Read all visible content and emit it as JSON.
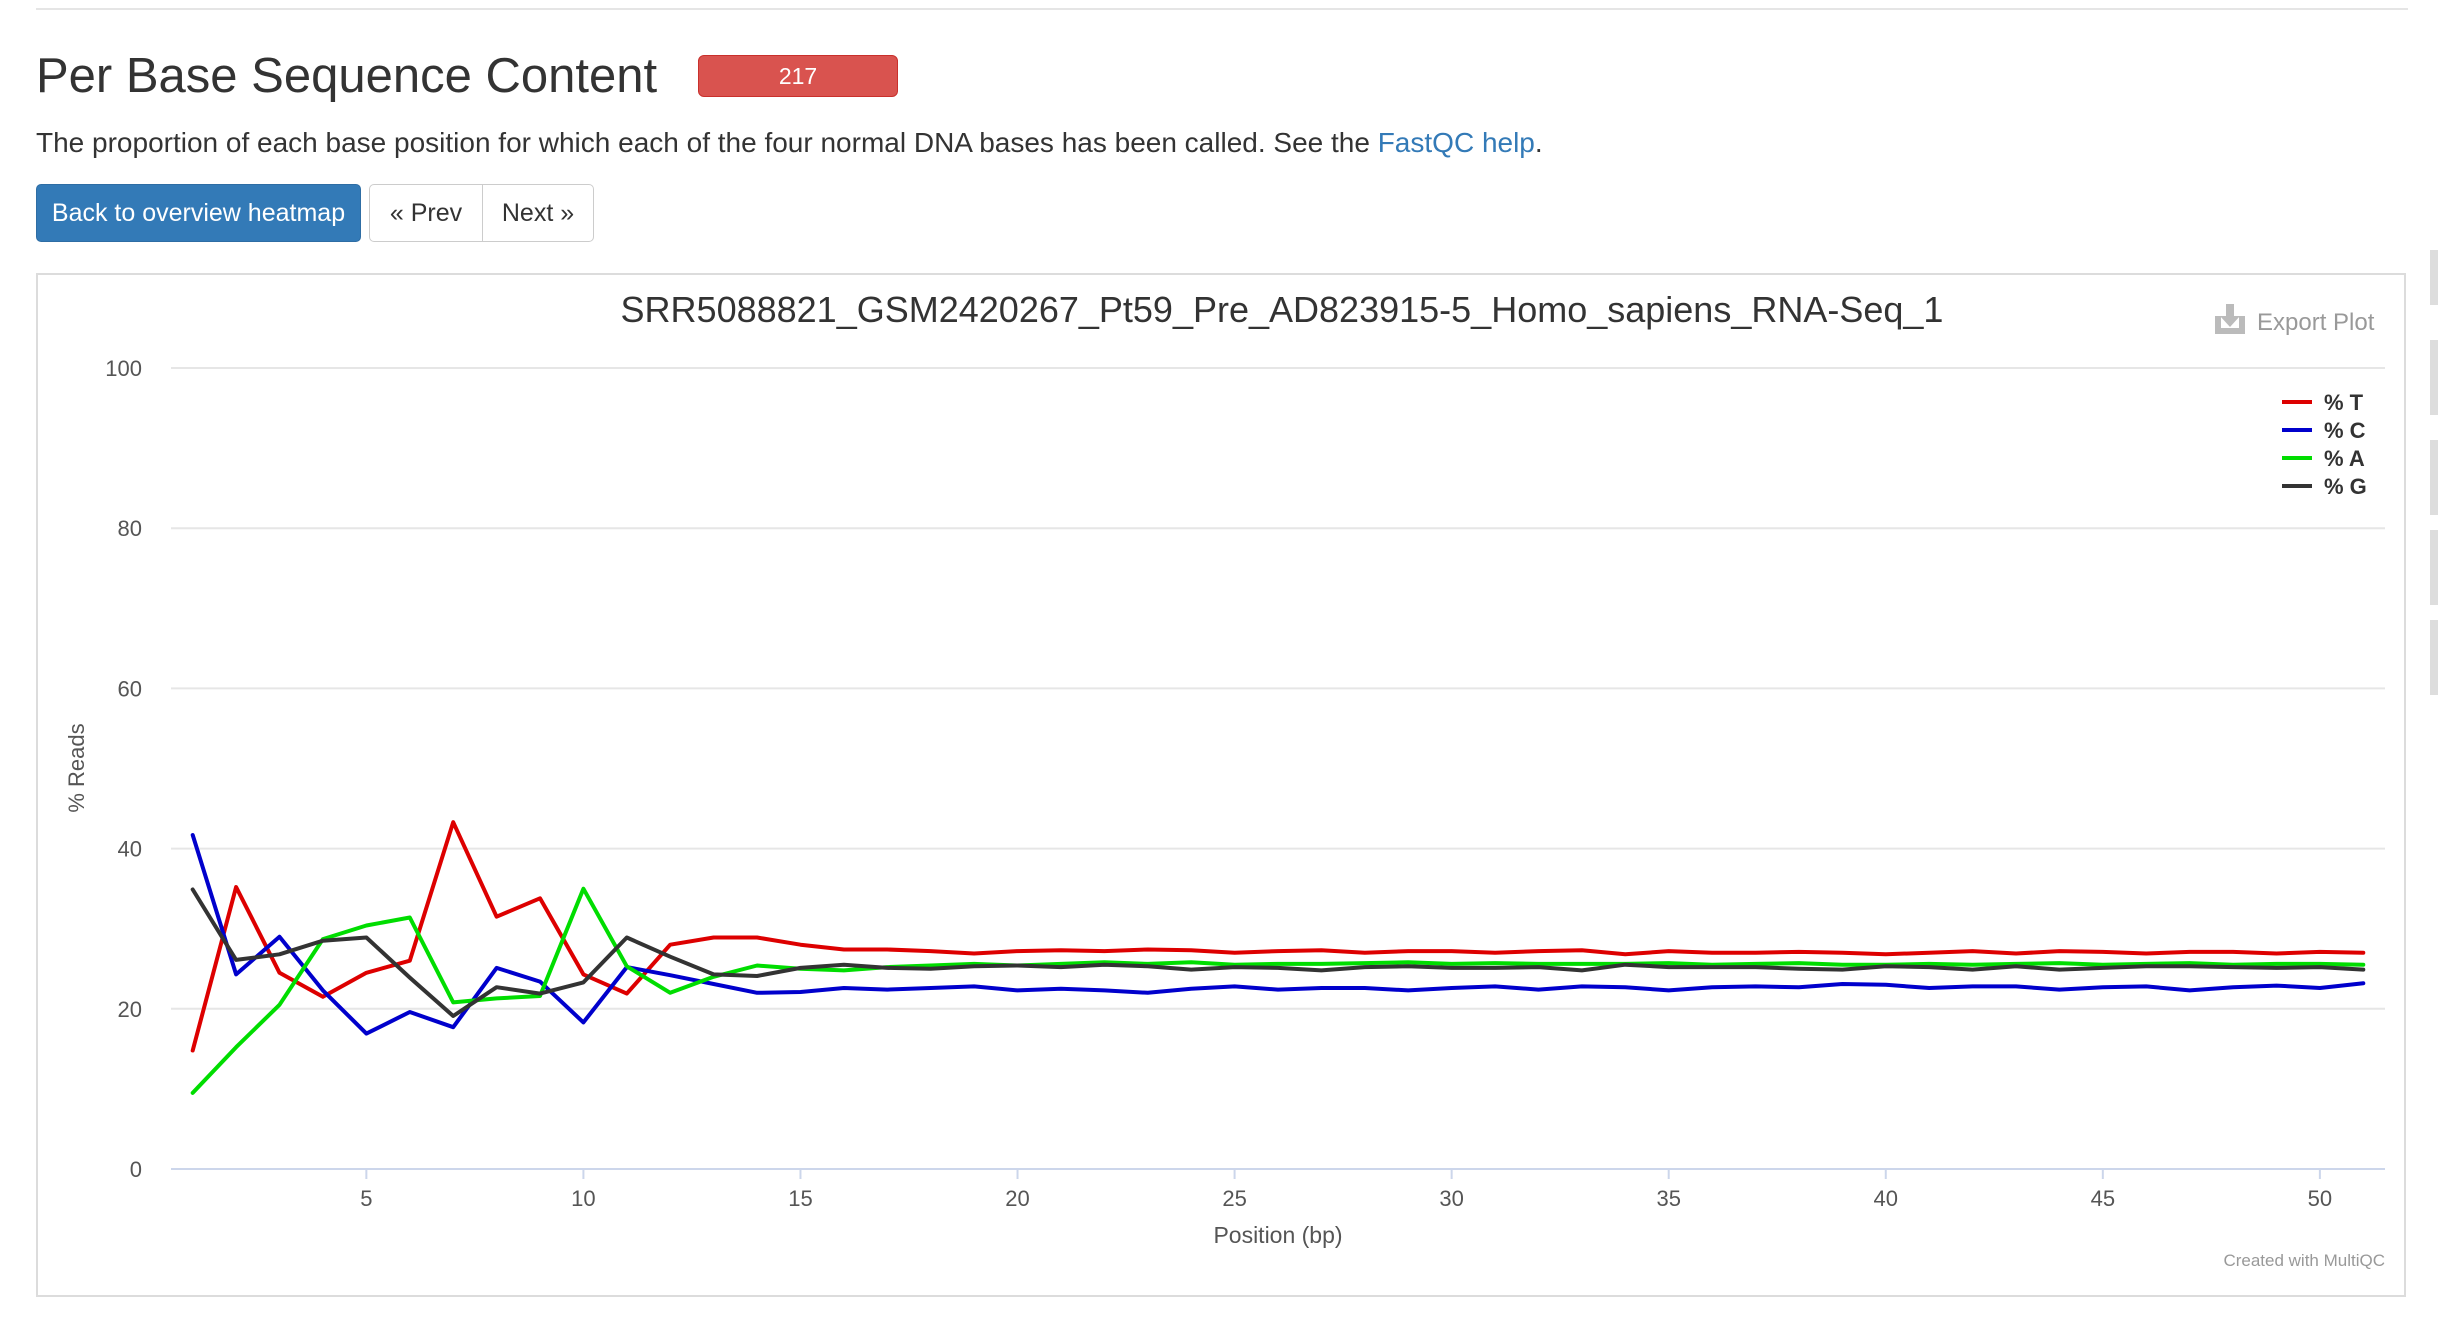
{
  "section": {
    "title": "Per Base Sequence Content",
    "badge": "217",
    "description_before": "The proportion of each base position for which each of the four normal DNA bases has been called. See the ",
    "help_link": "FastQC help",
    "description_after": "."
  },
  "nav": {
    "back_label": "Back to overview heatmap",
    "prev_label": "« Prev",
    "next_label": "Next »"
  },
  "plot": {
    "export_label": "Export Plot",
    "credit": "Created with MultiQC"
  },
  "chart_data": {
    "type": "line",
    "title": "SRR5088821_GSM2420267_Pt59_Pre_AD823915-5_Homo_sapiens_RNA-Seq_1",
    "xlabel": "Position (bp)",
    "ylabel": "% Reads",
    "xlim": [
      1,
      51
    ],
    "ylim": [
      0,
      100
    ],
    "xticks": [
      5,
      10,
      15,
      20,
      25,
      30,
      35,
      40,
      45,
      50
    ],
    "yticks": [
      0,
      20,
      40,
      60,
      80,
      100
    ],
    "grid": true,
    "legend_position": "top-right",
    "x": [
      1,
      2,
      3,
      4,
      5,
      6,
      7,
      8,
      9,
      10,
      11,
      12,
      13,
      14,
      15,
      16,
      17,
      18,
      19,
      20,
      21,
      22,
      23,
      24,
      25,
      26,
      27,
      28,
      29,
      30,
      31,
      32,
      33,
      34,
      35,
      36,
      37,
      38,
      39,
      40,
      41,
      42,
      43,
      44,
      45,
      46,
      47,
      48,
      49,
      50,
      51
    ],
    "series": [
      {
        "name": "% T",
        "color": "#dd0000",
        "values": [
          14.8,
          35.2,
          24.5,
          21.5,
          24.5,
          26.0,
          43.3,
          31.5,
          33.8,
          24.3,
          21.9,
          28.0,
          28.9,
          28.9,
          28.0,
          27.4,
          27.4,
          27.2,
          26.9,
          27.2,
          27.3,
          27.2,
          27.4,
          27.3,
          27.0,
          27.2,
          27.3,
          27.0,
          27.2,
          27.2,
          27.0,
          27.2,
          27.3,
          26.8,
          27.2,
          27.0,
          27.0,
          27.1,
          27.0,
          26.8,
          27.0,
          27.2,
          26.9,
          27.2,
          27.1,
          26.9,
          27.1,
          27.1,
          26.9,
          27.1,
          27.0
        ]
      },
      {
        "name": "% C",
        "color": "#0000cc",
        "values": [
          41.7,
          24.3,
          29.0,
          22.3,
          16.9,
          19.6,
          17.7,
          25.1,
          23.4,
          18.3,
          25.2,
          24.2,
          23.1,
          22.0,
          22.1,
          22.6,
          22.4,
          22.6,
          22.8,
          22.3,
          22.5,
          22.3,
          22.0,
          22.5,
          22.8,
          22.4,
          22.6,
          22.6,
          22.3,
          22.6,
          22.8,
          22.4,
          22.8,
          22.7,
          22.3,
          22.7,
          22.8,
          22.7,
          23.1,
          23.0,
          22.6,
          22.8,
          22.8,
          22.4,
          22.7,
          22.8,
          22.3,
          22.7,
          22.9,
          22.6,
          23.2
        ]
      },
      {
        "name": "% A",
        "color": "#00dd00",
        "values": [
          9.5,
          15.2,
          20.5,
          28.7,
          30.4,
          31.4,
          20.8,
          21.3,
          21.6,
          35.0,
          25.3,
          22.0,
          24.0,
          25.4,
          25.0,
          24.8,
          25.2,
          25.4,
          25.6,
          25.4,
          25.6,
          25.8,
          25.6,
          25.8,
          25.5,
          25.6,
          25.6,
          25.7,
          25.8,
          25.6,
          25.7,
          25.6,
          25.6,
          25.6,
          25.7,
          25.5,
          25.6,
          25.7,
          25.5,
          25.5,
          25.6,
          25.5,
          25.6,
          25.7,
          25.5,
          25.6,
          25.7,
          25.5,
          25.6,
          25.6,
          25.5
        ]
      },
      {
        "name": "% G",
        "color": "#333333",
        "values": [
          34.9,
          26.1,
          26.8,
          28.5,
          28.9,
          23.9,
          19.1,
          22.7,
          21.9,
          23.3,
          28.9,
          26.5,
          24.3,
          24.1,
          25.1,
          25.5,
          25.1,
          25.0,
          25.3,
          25.4,
          25.2,
          25.5,
          25.3,
          24.9,
          25.2,
          25.1,
          24.8,
          25.2,
          25.3,
          25.1,
          25.1,
          25.2,
          24.8,
          25.5,
          25.2,
          25.2,
          25.2,
          25.0,
          24.9,
          25.3,
          25.2,
          24.9,
          25.3,
          24.9,
          25.1,
          25.3,
          25.3,
          25.2,
          25.1,
          25.2,
          24.9
        ]
      }
    ]
  }
}
